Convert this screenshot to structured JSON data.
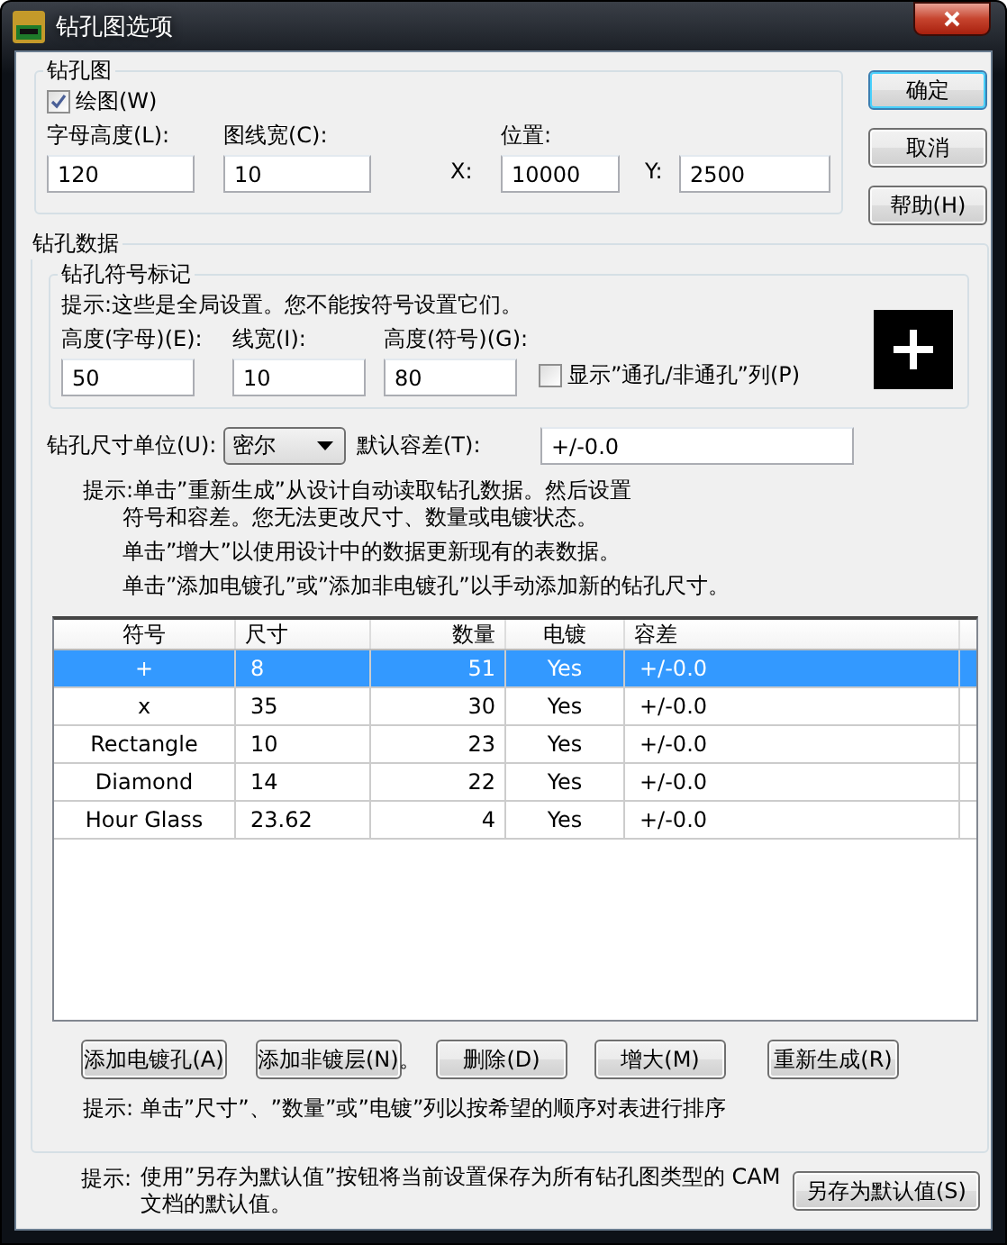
{
  "window": {
    "title": "钻孔图选项"
  },
  "drill_drawing": {
    "title": "钻孔图",
    "draw_checkbox": {
      "label": "绘图(W)",
      "checked": true
    },
    "fields": [
      {
        "label": "字母高度(L):",
        "value": "120"
      },
      {
        "label": "图线宽(C):",
        "value": "10"
      }
    ],
    "position": {
      "label": "位置:",
      "x_label": "X:",
      "x_value": "10000",
      "y_label": "Y:",
      "y_value": "2500"
    }
  },
  "dialog_buttons": [
    {
      "label": "确定",
      "default": true
    },
    {
      "label": "取消",
      "default": false
    },
    {
      "label": "帮助(H)",
      "default": false
    }
  ],
  "drill_data": {
    "title": "钻孔数据",
    "symbol_group": {
      "title": "钻孔符号标记",
      "hint": "提示:这些是全局设置。您不能按符号设置它们。",
      "fields": [
        {
          "label": "高度(字母)(E):",
          "value": "50"
        },
        {
          "label": "线宽(I):",
          "value": "10"
        },
        {
          "label": "高度(符号)(G):",
          "value": "80"
        }
      ],
      "show_column_checkbox": {
        "label": "显示”通孔/非通孔”列(P)",
        "checked": false
      }
    },
    "units": {
      "label": "钻孔尺寸单位(U):",
      "value": "密尔"
    },
    "tolerance": {
      "label": "默认容差(T):",
      "value": "+/-0.0"
    },
    "regenerate_hint": [
      "提示:单击”重新生成”从设计自动读取钻孔数据。然后设置",
      "符号和容差。您无法更改尺寸、数量或电镀状态。"
    ],
    "notes": [
      "单击”增大”以使用设计中的数据更新现有的表数据。",
      "单击”添加电镀孔”或”添加非电镀孔”以手动添加新的钻孔尺寸。"
    ],
    "table": {
      "columns": [
        "符号",
        "尺寸",
        "数量",
        "电镀",
        "容差"
      ],
      "rows": [
        {
          "cells": [
            "+",
            "8",
            "51",
            "Yes",
            "+/-0.0"
          ],
          "selected": true
        },
        {
          "cells": [
            "x",
            "35",
            "30",
            "Yes",
            "+/-0.0"
          ],
          "selected": false
        },
        {
          "cells": [
            "Rectangle",
            "10",
            "23",
            "Yes",
            "+/-0.0"
          ],
          "selected": false
        },
        {
          "cells": [
            "Diamond",
            "14",
            "22",
            "Yes",
            "+/-0.0"
          ],
          "selected": false
        },
        {
          "cells": [
            "Hour Glass",
            "23.62",
            "4",
            "Yes",
            "+/-0.0"
          ],
          "selected": false
        }
      ]
    },
    "buttons": [
      "添加电镀孔(A)",
      "添加非镀层(N)。",
      "删除(D)",
      "增大(M)",
      "重新生成(R)"
    ],
    "sort_hint": "提示: 单击”尺寸”、”数量”或”电镀”列以按希望的顺序对表进行排序"
  },
  "footer": {
    "hint_label": "提示:",
    "hint_lines": [
      "使用”另存为默认值”按钮将当前设置保存为所有钻孔图类型的 CAM",
      "文档的默认值。"
    ],
    "button": "另存为默认值(S)"
  }
}
